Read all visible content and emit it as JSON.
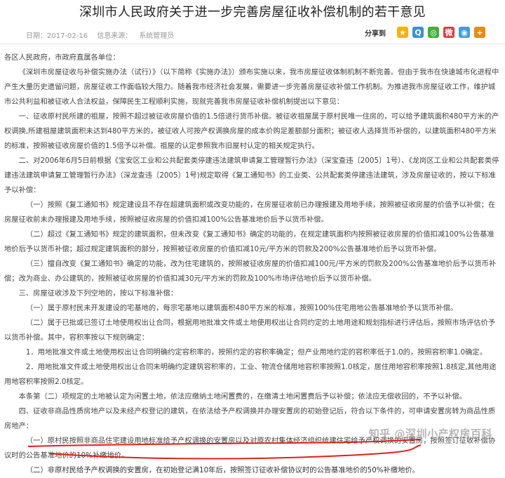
{
  "title": "深圳市人民政府关于进一步完善房屋征收补偿机制的若干意见",
  "meta": {
    "date": "日期：2017-02-16",
    "source": "信息来源：",
    "author": "系统管理员"
  },
  "share": {
    "label": "分享到",
    "icons": [
      {
        "name": "qzone-star-icon",
        "color": "#f6b400",
        "glyph": "★"
      },
      {
        "name": "qq-icon",
        "color": "#3d8fd6",
        "glyph": "Q"
      },
      {
        "name": "wechat-icon",
        "color": "#3bb335",
        "glyph": "◎"
      },
      {
        "name": "weibo-icon",
        "color": "#e4393c",
        "glyph": "微"
      },
      {
        "name": "tencent-weibo-icon",
        "color": "#3aa1e0",
        "glyph": "◉"
      },
      {
        "name": "more-plus-icon",
        "color": "#f08a00",
        "glyph": "+"
      }
    ]
  },
  "paragraphs": [
    "各区人民政府，市政府直属各单位：",
    "《深圳市房屋征收与补偿实施办法（试行）》（以下简称《实施办法》）颁布实施以来，我市房屋征收体制机制不断完善。但由于我市在快速城市化进程中产生大量历史遗留问题，房屋征收工作面临较大阻力。随着我市经济社会发展，需要进一步完善房屋征收补偿工作机制。为推进我市房屋征收工作，维护城市公共利益和被征收人合法权益，保障民生工程顺利实施，现就完善我市房屋征收补偿机制提出以下意见：",
    "一、征收原村民所建的祖屋，按照不超过被征收房屋价值的1.5倍进行货币补偿。被征收祖屋属于原村民唯一住房的，可以给予建筑面积480平方米的产权调换,所建祖屋建筑面积未达到480平方米的，被征收人可按产权调换房屋的成本价购足差额部分面积；被征收人选择货币补偿的，以建筑面积480平方米的标准，按照被征收房屋价值的1.5倍予以补偿。祖屋的认定参照我市旧屋村认定的相关规定执行。",
    "二、对2006年6月5日前根据《宝安区工业和公共配套类停建违法建筑申请复工管理暂行办法》（深宝查违〔2005〕1号）、《龙岗区工业和公共配套类停建违法建筑申请复工管理暂行办法》（深龙查违〔2005〕1号)规定取得《复工通知书》的工业类、公共配套类停建违法建筑，涉及房屋征收的，按以下标准予以补偿：",
    "（一）按照《复工通知书》规定建设且不存在超建筑面积或改变功能的，在房屋征收前已办理报建及用地手续，按照被征收房屋的价值予以补偿；在房屋征收前未办理报建及用地手续，按照被征收房屋的价值扣减100%公告基准地价后予以货币补偿。",
    "（二）超过《复工通知书》规定的建筑面积，但未改变《复工通知书》确定的功能的，在规定建筑面积内按照被征收房屋的价值扣减100%公告基准地价后予以货币补偿；超过规定建筑面积的部分，按照被征收房屋的价值扣减10元/平方米的罚款及200%公告基准地价后予以货币补偿。",
    "（三）擅自改变《复工通知书》确定的功能，改为住宅建筑的，按照被征收房屋的价值扣减100元/平方米的罚款及200%公告基准地价后予以货币补偿；改为商业、办公建筑的，按照被征收房屋的价值扣减30元/平方米的罚款及100%市场评估地价后予以货币补偿。",
    "三、房屋征收涉及下列空地的，按以下标准补偿：",
    "（一）属于原村民未开发建设的宅基地的，每宗宅基地以建筑面积480平方米的标准，按照100%住宅用地公告基准地价予以货币补偿。",
    "（二）属于已批或已签订土地使用权出让合同，根据用地批准文件或土地使用权出让合同约定的土地用途和规划指标进行评估后，按照市场评估价予以货币补偿。其中，容积率按以下规则确定：",
    "1．用地批准文件或土地使用权出让合同明确约定容积率的，按照约定的容积率确定；但产业用地约定的容积率低于1.0的，按照容积率1.0确定。",
    "2．用地批准文件或土地使用权出让合同未明确约定建筑容积率的，工业、物流仓储用地容积率按照1.0核定，居住用地容积率按照1.8核定,其他用途用地容积率按照2.0核定。",
    "本条第（二）项规定的土地被认定为闲置土地，依法应缴纳土地闲置费的，在缴清土地闲置费后予以补偿；依法应无偿收回的，不予以补偿。",
    "四、征收非商品性质房地产以及未经产权登记的建筑，在依法给予产权调换并办理安置房的初始登记后，符合以下条件的，可申请安置房转为商品性质房地产：",
    "（一）原村民按照非商品住宅建设用地标准给予产权调换的安置房以及对原农村集体经济组织统建住宅给予产权调换的安置房，按照签订征收补偿协议时的公告基准地价的10%补缴地价。",
    "（二）非原村民给予产权调换的安置房，在初始登记满10年后，按照签订征收补偿协议时的公告基准地价的50%补缴地价。"
  ],
  "watermark": "知乎 @深圳小产权房百科"
}
